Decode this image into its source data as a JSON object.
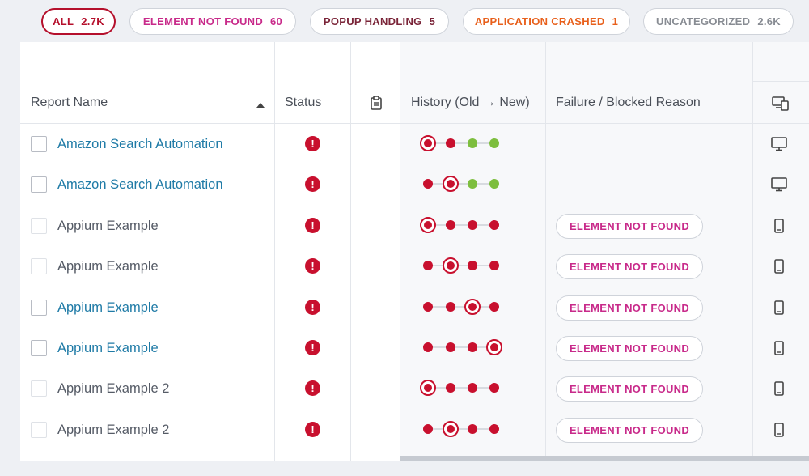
{
  "filters": [
    {
      "label": "ALL",
      "count": "2.7K",
      "color": "#b5102c",
      "active": true
    },
    {
      "label": "ELEMENT NOT FOUND",
      "count": "60",
      "color": "#c82a8a"
    },
    {
      "label": "POPUP HANDLING",
      "count": "5",
      "color": "#7a2438"
    },
    {
      "label": "APPLICATION CRASHED",
      "count": "1",
      "color": "#e8601c"
    },
    {
      "label": "UNCATEGORIZED",
      "count": "2.6K",
      "color": "#888c93"
    }
  ],
  "table": {
    "columns": {
      "report_name": "Report Name",
      "status": "Status",
      "notes_icon": "clipboard-icon",
      "history": "History (Old → New)",
      "reason": "Failure / Blocked Reason",
      "device_icon": "devices-icon"
    },
    "sort": {
      "column": "report_name",
      "direction": "ascending"
    },
    "rows": [
      {
        "name": "Amazon Search Automation",
        "link": true,
        "status": "!",
        "history": [
          "fail",
          "fail",
          "pass",
          "pass"
        ],
        "current": 0,
        "reason": "",
        "device": "desktop-icon"
      },
      {
        "name": "Amazon Search Automation",
        "link": true,
        "status": "!",
        "history": [
          "fail",
          "fail",
          "pass",
          "pass"
        ],
        "current": 1,
        "reason": "",
        "device": "desktop-icon"
      },
      {
        "name": "Appium Example",
        "link": false,
        "status": "!",
        "history": [
          "fail",
          "fail",
          "fail",
          "fail"
        ],
        "current": 0,
        "reason": "ELEMENT NOT FOUND",
        "device": "mobile-icon"
      },
      {
        "name": "Appium Example",
        "link": false,
        "status": "!",
        "history": [
          "fail",
          "fail",
          "fail",
          "fail"
        ],
        "current": 1,
        "reason": "ELEMENT NOT FOUND",
        "device": "mobile-icon"
      },
      {
        "name": "Appium Example",
        "link": true,
        "status": "!",
        "history": [
          "fail",
          "fail",
          "fail",
          "fail"
        ],
        "current": 2,
        "reason": "ELEMENT NOT FOUND",
        "device": "mobile-icon"
      },
      {
        "name": "Appium Example",
        "link": true,
        "status": "!",
        "history": [
          "fail",
          "fail",
          "fail",
          "fail"
        ],
        "current": 3,
        "reason": "ELEMENT NOT FOUND",
        "device": "mobile-icon"
      },
      {
        "name": "Appium Example 2",
        "link": false,
        "status": "!",
        "history": [
          "fail",
          "fail",
          "fail",
          "fail"
        ],
        "current": 0,
        "reason": "ELEMENT NOT FOUND",
        "device": "mobile-icon"
      },
      {
        "name": "Appium Example 2",
        "link": false,
        "status": "!",
        "history": [
          "fail",
          "fail",
          "fail",
          "fail"
        ],
        "current": 1,
        "reason": "ELEMENT NOT FOUND",
        "device": "mobile-icon"
      }
    ]
  },
  "colors": {
    "fail": "#c8102e",
    "pass": "#7dbe3e",
    "link": "#1e7aa6",
    "reason": "#c82a8a"
  }
}
